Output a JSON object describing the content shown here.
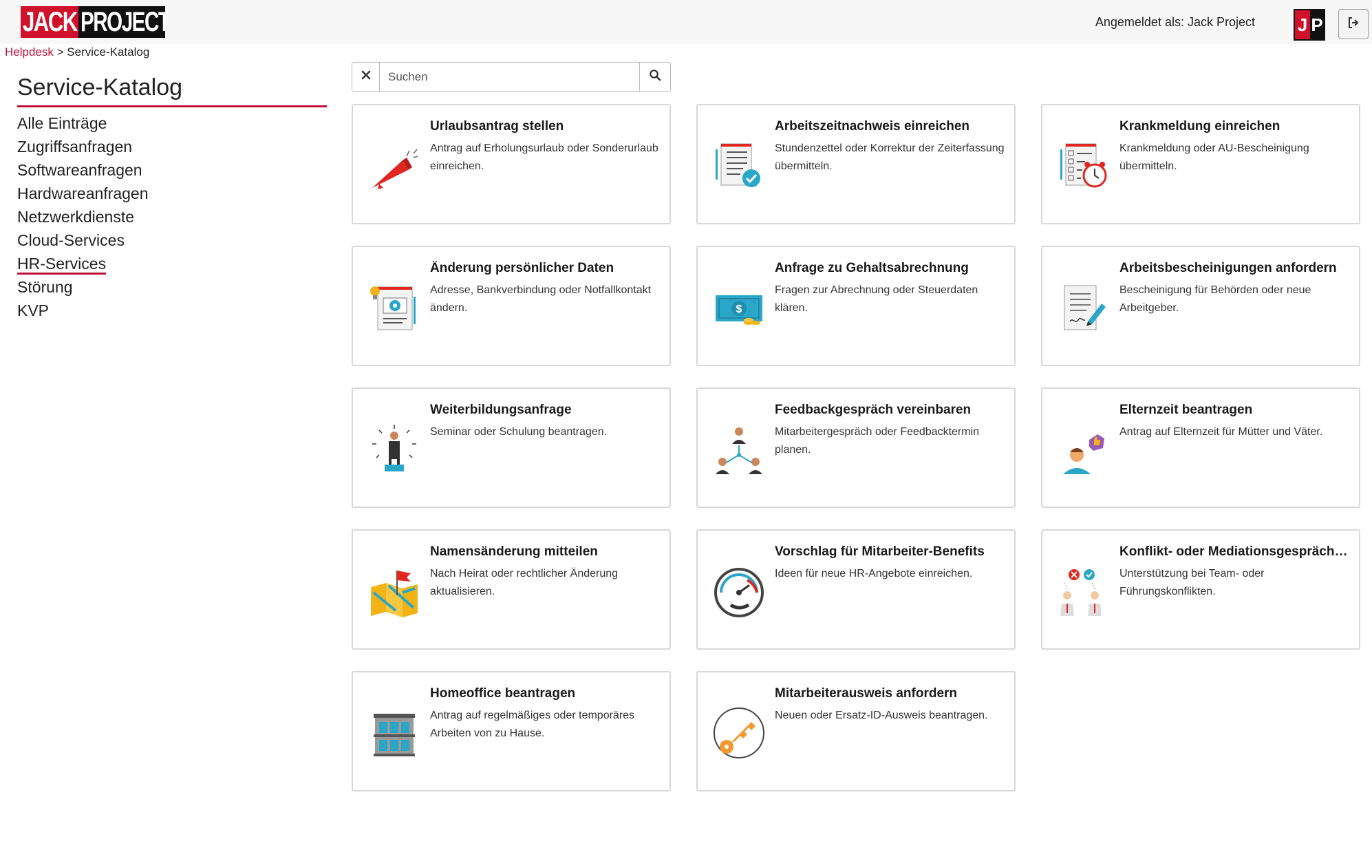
{
  "header": {
    "logo_text_left": "JACK",
    "logo_text_right": "PROJECT",
    "logged_in_label": "Angemeldet als: Jack Project",
    "avatar_left": "J",
    "avatar_right": "P",
    "logout_icon": "sign-out-icon"
  },
  "breadcrumb": {
    "root": "Helpdesk",
    "separator": ">",
    "current": "Service-Katalog"
  },
  "sidebar": {
    "title": "Service-Katalog",
    "items": [
      {
        "label": "Alle Einträge"
      },
      {
        "label": "Zugriffsanfragen"
      },
      {
        "label": "Softwareanfragen"
      },
      {
        "label": "Hardwareanfragen"
      },
      {
        "label": "Netzwerkdienste"
      },
      {
        "label": "Cloud-Services"
      },
      {
        "label": "HR-Services",
        "active": true
      },
      {
        "label": "Störung"
      },
      {
        "label": "KVP"
      }
    ]
  },
  "search": {
    "placeholder": "Suchen",
    "value": "",
    "clear_icon": "close-icon",
    "submit_icon": "search-icon"
  },
  "colors": {
    "accent": "#c0123a",
    "brand_red": "#d0112b",
    "brand_black": "#111111"
  },
  "cards": [
    {
      "title": "Urlaubsantrag stellen",
      "description": "Antrag auf Erholungsurlaub oder Sonderurlaub einreichen.",
      "icon": "megaphone-icon"
    },
    {
      "title": "Arbeitszeitnachweis einreichen",
      "description": "Stundenzettel oder Korrektur der Zeiterfassung übermitteln.",
      "icon": "checklist-approved-icon"
    },
    {
      "title": "Krankmeldung einreichen",
      "description": "Krankmeldung oder AU-Bescheinigung übermitteln.",
      "icon": "checklist-clock-icon"
    },
    {
      "title": "Änderung persönlicher Daten",
      "description": "Adresse, Bankverbindung oder Notfallkontakt ändern.",
      "icon": "document-settings-icon"
    },
    {
      "title": "Anfrage zu Gehaltsabrechnung",
      "description": "Fragen zur Abrechnung oder Steuerdaten klären.",
      "icon": "money-icon"
    },
    {
      "title": "Arbeitsbescheinigungen anfordern",
      "description": "Bescheinigung für Behörden oder neue Arbeitgeber.",
      "icon": "document-sign-icon"
    },
    {
      "title": "Weiterbildungsanfrage",
      "description": "Seminar oder Schulung beantragen.",
      "icon": "speaker-podium-icon"
    },
    {
      "title": "Feedbackgespräch vereinbaren",
      "description": "Mitarbeitergespräch oder Feedbacktermin planen.",
      "icon": "team-hierarchy-icon"
    },
    {
      "title": "Elternzeit beantragen",
      "description": "Antrag auf Elternzeit für Mütter und Väter.",
      "icon": "user-thumbs-up-icon"
    },
    {
      "title": "Namensänderung mitteilen",
      "description": "Nach Heirat oder rechtlicher Änderung aktualisieren.",
      "icon": "map-flag-icon"
    },
    {
      "title": "Vorschlag für Mitarbeiter-Benefits",
      "description": "Ideen für neue HR-Angebote einreichen.",
      "icon": "productivity-gauge-icon"
    },
    {
      "title": "Konflikt- oder Mediationsgespräch anfordern",
      "description": "Unterstützung bei Team- oder Führungskonflikten.",
      "icon": "decision-people-icon"
    },
    {
      "title": "Homeoffice beantragen",
      "description": "Antrag auf regelmäßiges oder temporäres Arbeiten von zu Hause.",
      "icon": "building-icon"
    },
    {
      "title": "Mitarbeiterausweis anfordern",
      "description": "Neuen oder Ersatz-ID-Ausweis beantragen.",
      "icon": "key-icon"
    }
  ]
}
